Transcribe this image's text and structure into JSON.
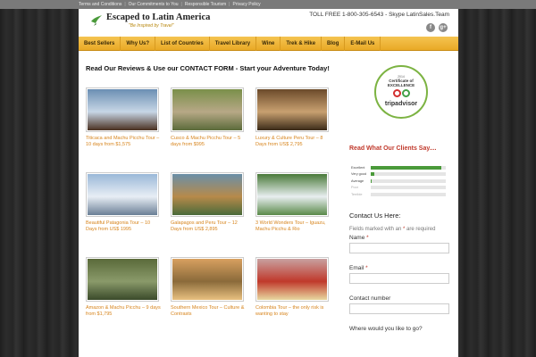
{
  "topbar": {
    "links": [
      "Terms and Conditions",
      "Our Commitments to You",
      "Responsible Tourism",
      "Privacy Policy"
    ]
  },
  "header": {
    "logo_title": "Escaped to Latin America",
    "logo_tagline": "\"Be Inspired by Travel\"",
    "phone": "TOLL FREE 1-800-305-6543 - Skype LatinSales.Team",
    "social": [
      "f",
      "g+"
    ]
  },
  "nav": [
    "Best Sellers",
    "Why Us?",
    "List of Countries",
    "Travel Library",
    "Wine",
    "Trek & Hike",
    "Blog",
    "E-Mail Us"
  ],
  "main": {
    "heading": "Read Our Reviews & Use our CONTACT FORM - Start your Adventure Today!",
    "tours": [
      {
        "caption": "Titicaca and Machu Picchu Tour – 10 days from $1,575",
        "colors": [
          "#6b8fb3",
          "#c7d6e6",
          "#4a3020"
        ]
      },
      {
        "caption": "Cusco & Machu Picchu Tour – 5 days from $995",
        "colors": [
          "#7a8f4a",
          "#b7a886",
          "#5b6b3a"
        ]
      },
      {
        "caption": "Luxury & Culture Peru Tour – 8 Days from US$ 2,795",
        "colors": [
          "#6b4a2a",
          "#c8a070",
          "#3a2a18"
        ]
      },
      {
        "caption": "Beautiful Patagonia Tour – 10 Days from US$ 1995",
        "colors": [
          "#9ab8d8",
          "#e8eef5",
          "#6a7f96"
        ]
      },
      {
        "caption": "Galapagos and Peru Tour – 12 Days from US$ 2,895",
        "colors": [
          "#6a8fa8",
          "#b78a4a",
          "#4a6a3a"
        ]
      },
      {
        "caption": "3 World Wonders Tour – Iguazu, Machu Picchu & Rio",
        "colors": [
          "#4a7a3a",
          "#e8eef0",
          "#5a8a4a"
        ]
      },
      {
        "caption": "Amazon & Machu Picchu – 9 days from $1,795",
        "colors": [
          "#5a6a3a",
          "#8a9a6a",
          "#3a4a2a"
        ]
      },
      {
        "caption": "Southern Mexico Tour – Culture & Contrasts",
        "colors": [
          "#d8a060",
          "#8a6a3a",
          "#e8c080"
        ]
      },
      {
        "caption": "Colombia Tour – the only risk is wanting to stay",
        "colors": [
          "#c8a0a0",
          "#c0392b",
          "#e8d8a0"
        ]
      }
    ]
  },
  "sidebar": {
    "badge": {
      "year": "2014",
      "line1": "Certificate of",
      "line2": "EXCELLENCE",
      "brand": "tripadvisor"
    },
    "reviews_heading": "Read What Our Clients Say....",
    "ratings": [
      {
        "label": "Excellent",
        "fraction": 0.94
      },
      {
        "label": "Very good",
        "fraction": 0.05
      },
      {
        "label": "Average",
        "fraction": 0.01
      },
      {
        "label": "Poor",
        "fraction": 0.0
      },
      {
        "label": "Terrible",
        "fraction": 0.0
      }
    ],
    "contact_heading": "Contact Us Here:",
    "required_note": "Fields marked with an",
    "required_note_end": "are required",
    "asterisk": "*",
    "fields": {
      "name": "Name",
      "email": "Email",
      "contact_number": "Contact number",
      "destination": "Where would you like to go?"
    }
  }
}
